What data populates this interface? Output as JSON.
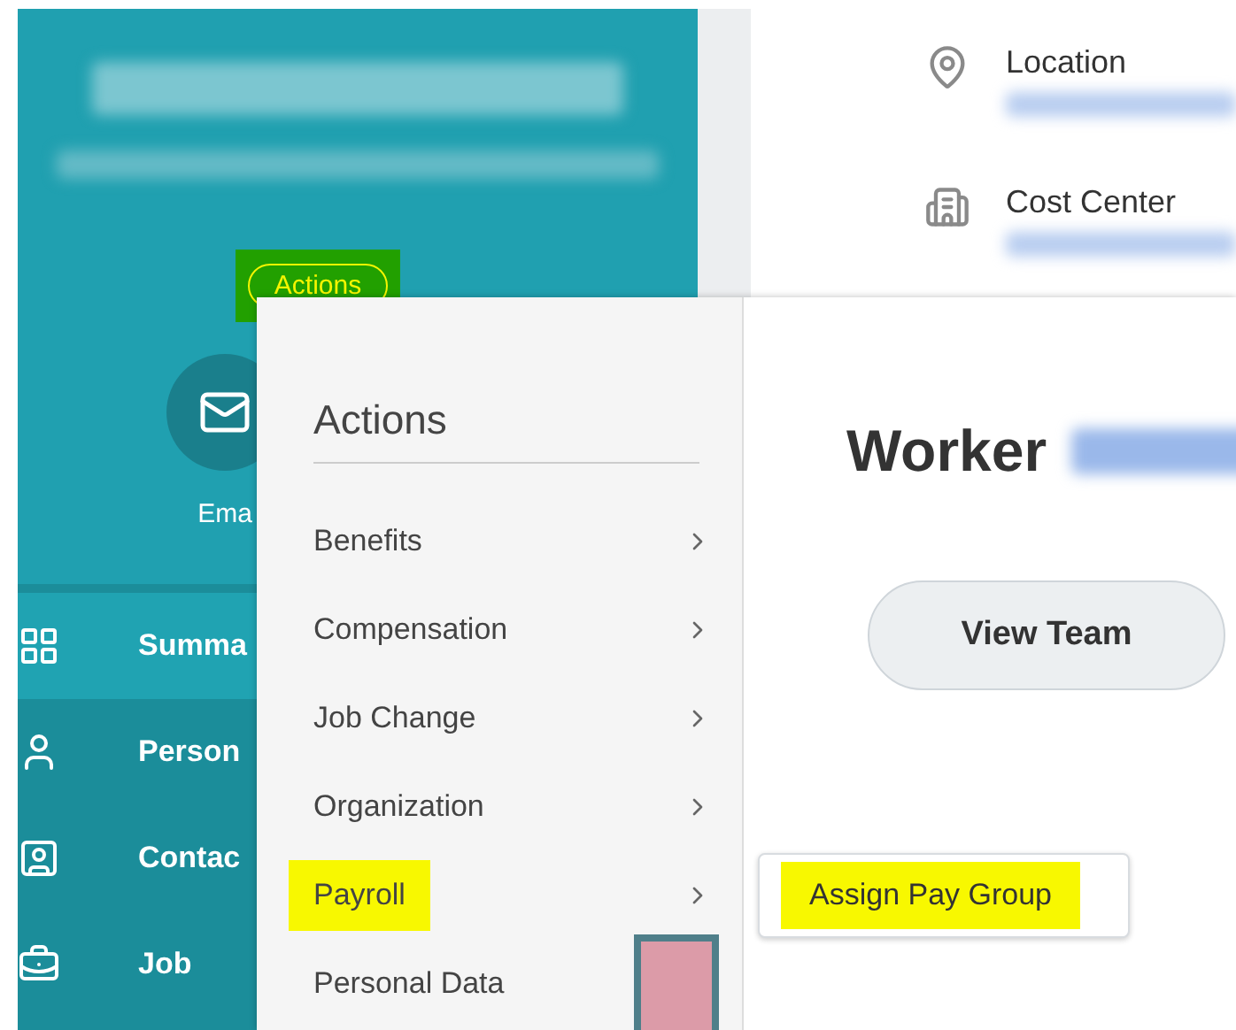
{
  "header": {
    "actions_button": "Actions",
    "highlighted": true
  },
  "email": {
    "label": "Ema"
  },
  "nav": [
    {
      "label": "Summa",
      "selected": true
    },
    {
      "label": "Person",
      "selected": false
    },
    {
      "label": "Contac",
      "selected": false
    },
    {
      "label": "Job",
      "selected": false
    }
  ],
  "details": [
    {
      "label": "Location"
    },
    {
      "label": "Cost Center"
    }
  ],
  "menu": {
    "title": "Actions",
    "items": [
      {
        "label": "Benefits",
        "highlighted": false,
        "submenu": true
      },
      {
        "label": "Compensation",
        "highlighted": false,
        "submenu": true
      },
      {
        "label": "Job Change",
        "highlighted": false,
        "submenu": true
      },
      {
        "label": "Organization",
        "highlighted": false,
        "submenu": true
      },
      {
        "label": "Payroll",
        "highlighted": true,
        "submenu": true
      },
      {
        "label": "Personal Data",
        "highlighted": false
      }
    ]
  },
  "submenu": {
    "items": [
      {
        "label": "Assign Pay Group",
        "highlighted": true
      }
    ]
  },
  "worker": {
    "title": "Worker",
    "button": "View Team"
  }
}
